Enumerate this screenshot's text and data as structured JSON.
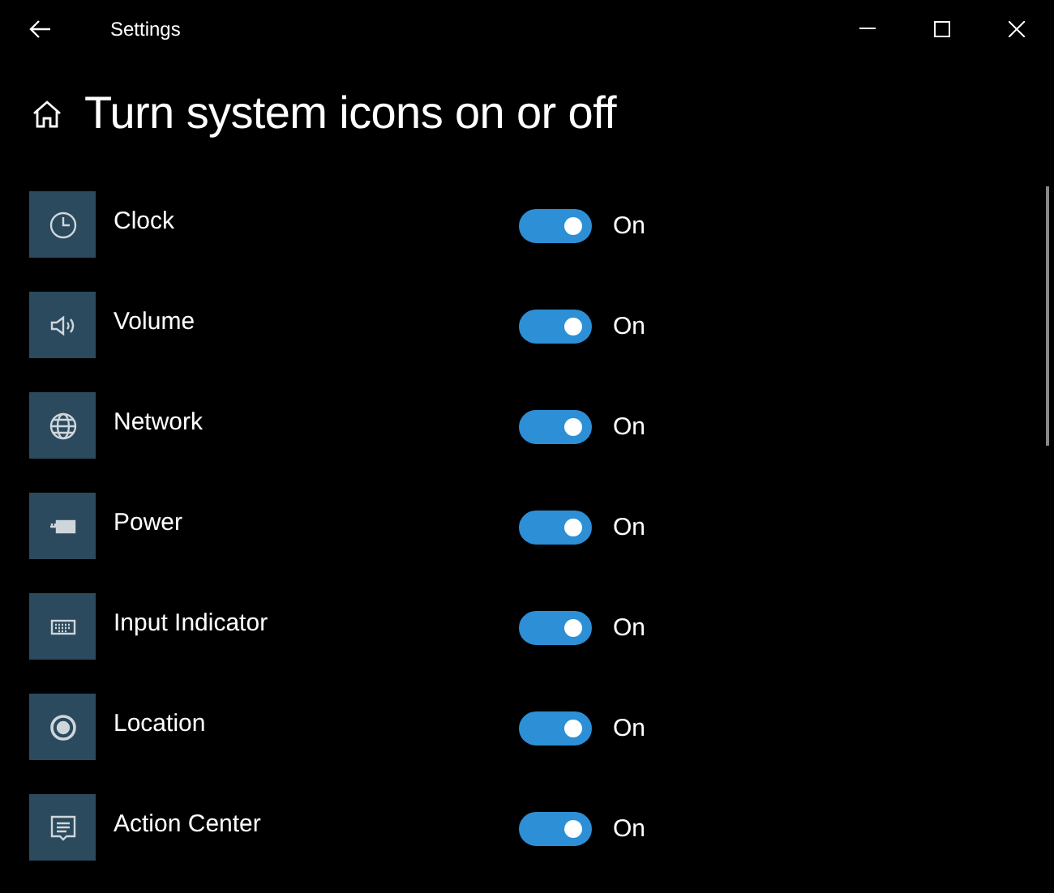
{
  "window": {
    "title": "Settings"
  },
  "page": {
    "title": "Turn system icons on or off"
  },
  "items": [
    {
      "label": "Clock",
      "on": true,
      "status": "On"
    },
    {
      "label": "Volume",
      "on": true,
      "status": "On"
    },
    {
      "label": "Network",
      "on": true,
      "status": "On"
    },
    {
      "label": "Power",
      "on": true,
      "status": "On"
    },
    {
      "label": "Input Indicator",
      "on": true,
      "status": "On"
    },
    {
      "label": "Location",
      "on": true,
      "status": "On"
    },
    {
      "label": "Action Center",
      "on": true,
      "status": "On"
    }
  ]
}
